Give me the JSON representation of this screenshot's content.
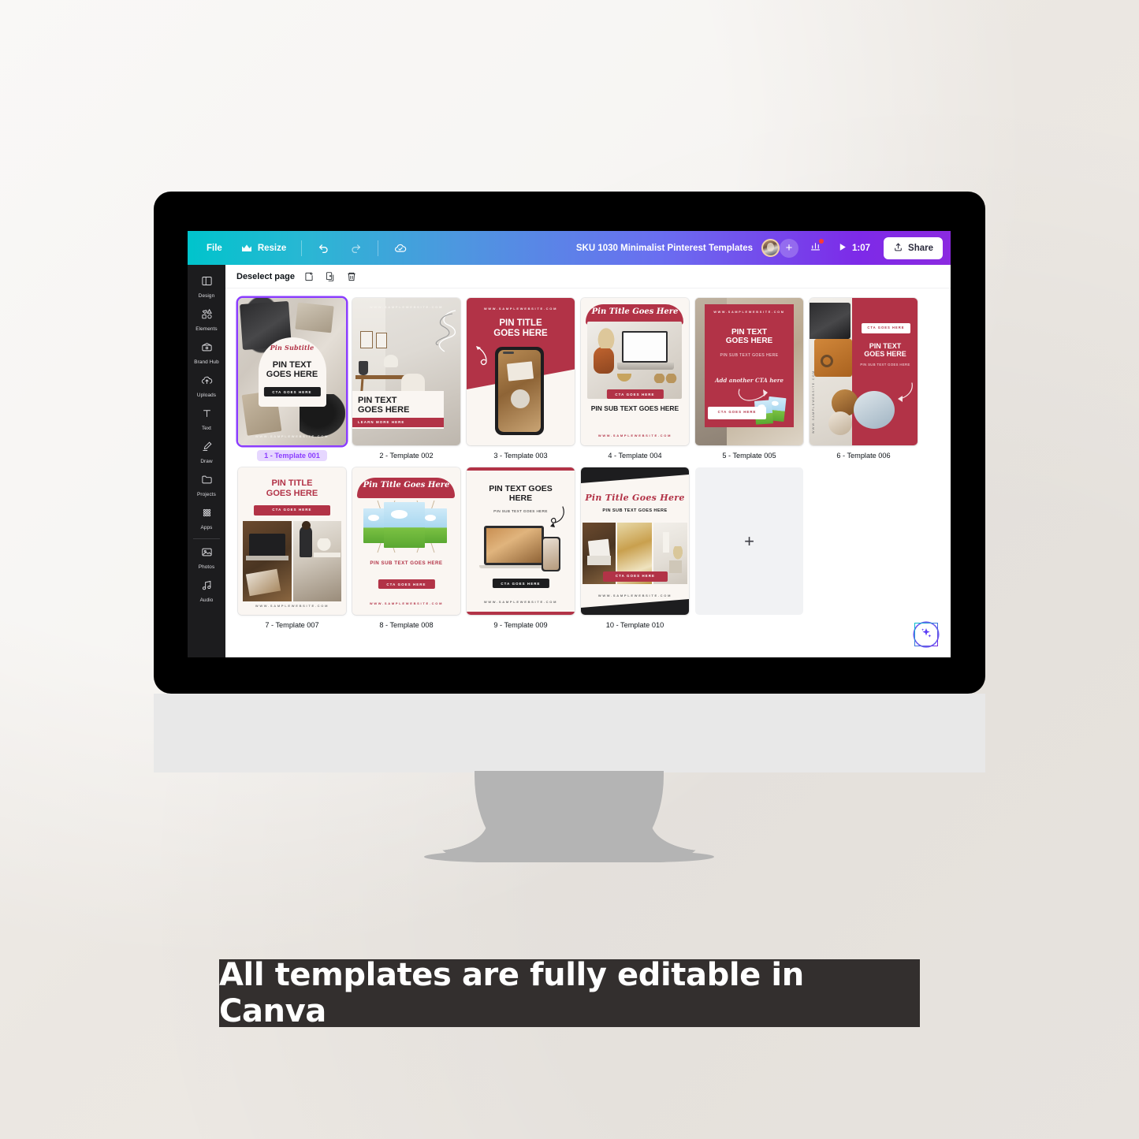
{
  "topbar": {
    "file_label": "File",
    "resize_label": "Resize",
    "undo_icon": "undo-icon",
    "redo_icon": "redo-icon",
    "cloud_icon": "cloud-saved-icon",
    "doc_title": "SKU 1030 Minimalist Pinterest Templates",
    "add_collaborator": "+",
    "insights_icon": "insights-bar-chart-icon",
    "play_icon": "play-icon",
    "timer": "1:07",
    "share_label": "Share",
    "share_icon": "share-upload-icon",
    "gradient_start": "#00c4cc",
    "gradient_end": "#8b2ae0"
  },
  "sidebar": {
    "items": [
      {
        "label": "Design",
        "icon": "design-panels-icon"
      },
      {
        "label": "Elements",
        "icon": "elements-shapes-icon"
      },
      {
        "label": "Brand Hub",
        "icon": "brand-hub-wallet-icon"
      },
      {
        "label": "Uploads",
        "icon": "uploads-cloud-icon"
      },
      {
        "label": "Text",
        "icon": "text-t-icon"
      },
      {
        "label": "Draw",
        "icon": "draw-pen-icon"
      },
      {
        "label": "Projects",
        "icon": "projects-folder-icon"
      },
      {
        "label": "Apps",
        "icon": "apps-grid-icon"
      },
      {
        "label": "Photos",
        "icon": "photos-image-icon"
      },
      {
        "label": "Audio",
        "icon": "audio-note-icon"
      }
    ]
  },
  "toolbar": {
    "deselect_label": "Deselect page",
    "add_page_icon": "add-page-icon",
    "duplicate_icon": "duplicate-page-icon",
    "delete_icon": "trash-delete-icon"
  },
  "canvas": {
    "add_page_label": "+",
    "magic_icon": "magic-sparkle-icon",
    "selected_page": 1,
    "accent": "#8b3dff",
    "brand_red": "#b23347",
    "pages": [
      {
        "number": 1,
        "label": "1 - Template 001",
        "selected": true,
        "script_text": "Pin Subtitle",
        "headline": "PIN TEXT\nGOES HERE",
        "cta": "CTA GOES HERE",
        "url": "WWW.SAMPLEWEBSITE.COM"
      },
      {
        "number": 2,
        "label": "2 - Template 002",
        "selected": false,
        "url_top": "WWW.SAMPLEWEBSITE.COM",
        "headline": "PIN TEXT\nGOES HERE",
        "cta": "LEARN MORE HERE"
      },
      {
        "number": 3,
        "label": "3 - Template 003",
        "selected": false,
        "url_top": "WWW.SAMPLEWEBSITE.COM",
        "headline": "PIN TITLE\nGOES HERE"
      },
      {
        "number": 4,
        "label": "4 - Template 004",
        "selected": false,
        "arc_title": "Pin Title Goes Here",
        "cta": "CTA GOES HERE",
        "subtext": "PIN SUB TEXT GOES HERE",
        "url": "WWW.SAMPLEWEBSITE.COM"
      },
      {
        "number": 5,
        "label": "5 - Template 005",
        "selected": false,
        "url_top": "WWW.SAMPLEWEBSITE.COM",
        "headline": "PIN TEXT\nGOES HERE",
        "subtext": "PIN SUB TEXT GOES HERE",
        "script_text": "Add another CTA here",
        "cta": "CTA GOES HERE"
      },
      {
        "number": 6,
        "label": "6 - Template 006",
        "selected": false,
        "cta": "CTA GOES HERE",
        "headline": "PIN TEXT\nGOES HERE",
        "subtext": "PIN SUB TEXT GOES HERE",
        "url_side": "WWW.SAMPLEWEBSITE.COM"
      },
      {
        "number": 7,
        "label": "7 - Template 007",
        "selected": false,
        "headline": "PIN TITLE\nGOES HERE",
        "cta": "CTA GOES HERE",
        "url": "WWW.SAMPLEWEBSITE.COM"
      },
      {
        "number": 8,
        "label": "8 - Template 008",
        "selected": false,
        "arc_title": "Pin Title Goes Here",
        "subtext": "PIN SUB TEXT GOES HERE",
        "cta": "CTA GOES HERE",
        "url": "WWW.SAMPLEWEBSITE.COM"
      },
      {
        "number": 9,
        "label": "9 - Template 009",
        "selected": false,
        "headline": "PIN TEXT GOES\nHERE",
        "subtext": "PIN SUB TEXT GOES HERE",
        "cta": "CTA GOES HERE",
        "url": "WWW.SAMPLEWEBSITE.COM"
      },
      {
        "number": 10,
        "label": "10 - Template 010",
        "selected": false,
        "script_text": "Pin Title Goes Here",
        "subtext": "PIN SUB TEXT GOES HERE",
        "cta": "CTA GOES HERE",
        "url": "WWW.SAMPLEWEBSITE.COM"
      }
    ]
  },
  "banner": {
    "text": "All templates are fully editable in Canva",
    "background": "#332f2e",
    "color": "#ffffff"
  }
}
